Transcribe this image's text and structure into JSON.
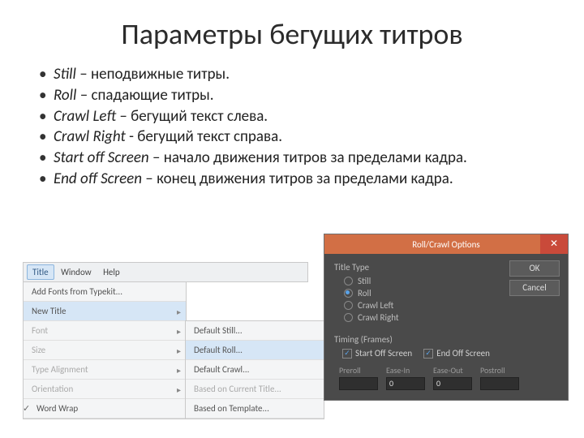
{
  "title": "Параметры бегущих титров",
  "bullets": [
    {
      "term": "Still",
      "desc": " – неподвижные титры."
    },
    {
      "term": "Roll",
      "desc": " – спадающие титры."
    },
    {
      "term": "Crawl Left",
      "desc": " – бегущий текст слева."
    },
    {
      "term": "Crawl Right",
      "desc": " - бегущий текст справа."
    },
    {
      "term": "Start off Screen",
      "desc": " – начало движения титров за пределами кадра."
    },
    {
      "term": "End off Screen",
      "desc": " – конец движения титров за пределами кадра."
    }
  ],
  "menu": {
    "bar": {
      "title": "Title",
      "window": "Window",
      "help": "Help"
    },
    "dropdown": {
      "add_fonts": "Add Fonts from Typekit...",
      "new_title": "New Title",
      "font": "Font",
      "size": "Size",
      "type_align": "Type Alignment",
      "orientation": "Orientation",
      "word_wrap": "Word Wrap"
    },
    "submenu": {
      "default_still": "Default Still...",
      "default_roll": "Default Roll...",
      "default_crawl": "Default Crawl...",
      "based_on_current": "Based on Current Title...",
      "based_on_template": "Based on Template..."
    }
  },
  "dialog": {
    "title": "Roll/Crawl Options",
    "close": "✕",
    "ok": "OK",
    "cancel": "Cancel",
    "group_title_type": "Title Type",
    "radio": {
      "still": "Still",
      "roll": "Roll",
      "crawl_left": "Crawl Left",
      "crawl_right": "Crawl Right"
    },
    "group_timing": "Timing (Frames)",
    "chk_start": "Start Off Screen",
    "chk_end": "End Off Screen",
    "cols": {
      "preroll": "Preroll",
      "ease_in": "Ease-In",
      "ease_out": "Ease-Out",
      "postroll": "Postroll"
    },
    "vals": {
      "preroll": "",
      "ease_in": "0",
      "ease_out": "0",
      "postroll": ""
    }
  }
}
